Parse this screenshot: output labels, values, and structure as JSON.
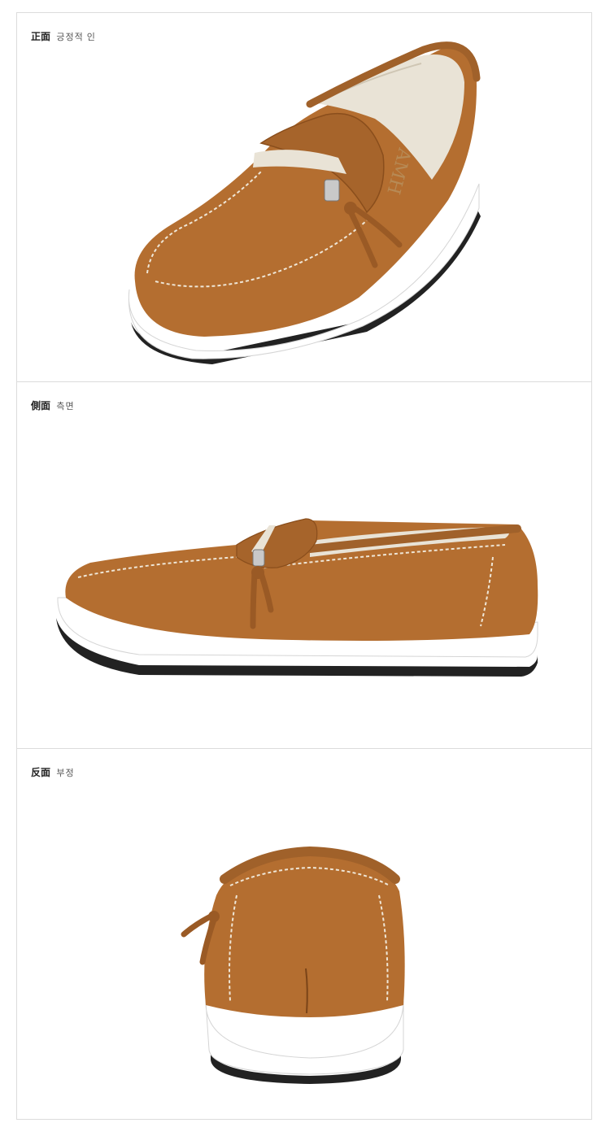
{
  "colors": {
    "leather": "#b46e30",
    "leather_dark": "#8a4e1c",
    "sole": "#ffffff",
    "outsole": "#222222",
    "lining": "#e9e3d6",
    "stitch": "#efe6d6"
  },
  "panels": [
    {
      "caption_cn": "正面",
      "caption_kr": "긍정적 인",
      "image": "shoe-front-three-quarter-view",
      "insole_text": "AMH"
    },
    {
      "caption_cn": "側面",
      "caption_kr": "측면",
      "image": "shoe-side-view"
    },
    {
      "caption_cn": "反面",
      "caption_kr": "부정",
      "image": "shoe-back-view"
    }
  ]
}
